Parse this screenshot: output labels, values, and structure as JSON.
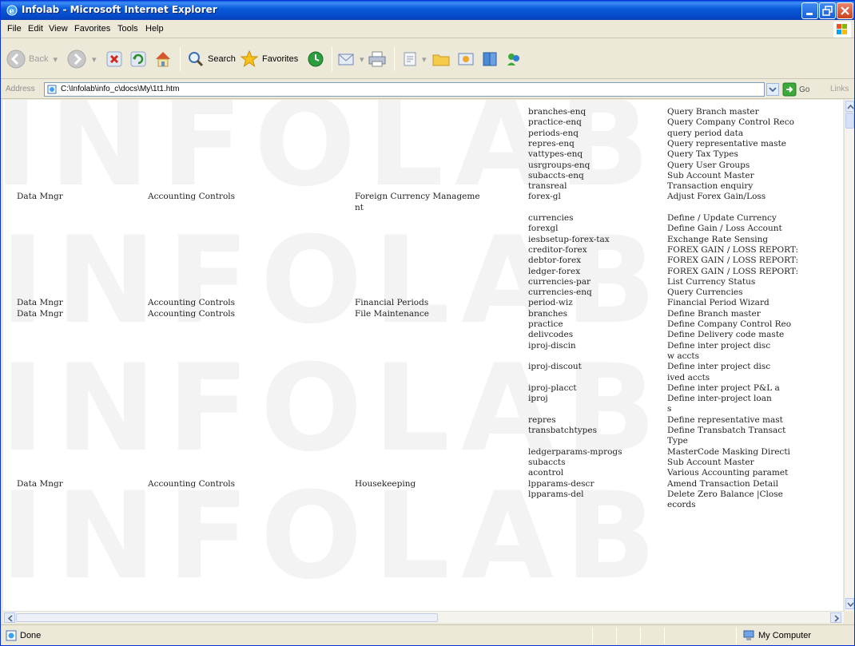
{
  "window": {
    "title": "Infolab - Microsoft Internet Explorer"
  },
  "menu": {
    "items": [
      "File",
      "Edit",
      "View",
      "Favorites",
      "Tools",
      "Help"
    ]
  },
  "toolbar": {
    "back_label": "Back",
    "search_label": "Search",
    "favorites_label": "Favorites"
  },
  "address": {
    "label": "Address",
    "url": "C:\\Infolab\\info_c\\docs\\My\\1t1.htm",
    "go_label": "Go",
    "links_label": "Links"
  },
  "watermark": {
    "text": "INFOLAB"
  },
  "report": {
    "rows": [
      {
        "c1": "",
        "c2": "",
        "c3": "",
        "c4": "branches-enq",
        "c5": "Query Branch master"
      },
      {
        "c1": "",
        "c2": "",
        "c3": "",
        "c4": "practice-enq",
        "c5": "Query Company Control Reco"
      },
      {
        "c1": "",
        "c2": "",
        "c3": "",
        "c4": "periods-enq",
        "c5": "query period data"
      },
      {
        "c1": "",
        "c2": "",
        "c3": "",
        "c4": "repres-enq",
        "c5": "Query representative maste"
      },
      {
        "c1": "",
        "c2": "",
        "c3": "",
        "c4": "vattypes-enq",
        "c5": "Query Tax Types"
      },
      {
        "c1": "",
        "c2": "",
        "c3": "",
        "c4": "usrgroups-enq",
        "c5": "Query User Groups"
      },
      {
        "c1": "",
        "c2": "",
        "c3": "",
        "c4": "subaccts-enq",
        "c5": "Sub Account Master"
      },
      {
        "c1": "",
        "c2": "",
        "c3": "",
        "c4": "transreal",
        "c5": "Transaction enquiry"
      },
      {
        "c1": "Data Mngr",
        "c2": "Accounting Controls",
        "c3": "Foreign Currency Manageme",
        "c4": "forex-gl",
        "c5": "Adjust Forex Gain/Loss"
      },
      {
        "c1": "",
        "c2": "",
        "c3": "nt",
        "c4": "",
        "c5": ""
      },
      {
        "c1": "",
        "c2": "",
        "c3": "",
        "c4": "currencies",
        "c5": "Define / Update Currency"
      },
      {
        "c1": "",
        "c2": "",
        "c3": "",
        "c4": "forexgl",
        "c5": "Define Gain / Loss Account"
      },
      {
        "c1": "",
        "c2": "",
        "c3": "",
        "c4": "iesbsetup-forex-tax",
        "c5": "Exchange Rate Sensing"
      },
      {
        "c1": "",
        "c2": "",
        "c3": "",
        "c4": "creditor-forex",
        "c5": "FOREX GAIN / LOSS REPORT:"
      },
      {
        "c1": "",
        "c2": "",
        "c3": "",
        "c4": "debtor-forex",
        "c5": "FOREX GAIN / LOSS REPORT:"
      },
      {
        "c1": "",
        "c2": "",
        "c3": "",
        "c4": "ledger-forex",
        "c5": "FOREX GAIN / LOSS REPORT:"
      },
      {
        "c1": "",
        "c2": "",
        "c3": "",
        "c4": "currencies-par",
        "c5": "List Currency Status"
      },
      {
        "c1": "",
        "c2": "",
        "c3": "",
        "c4": "currencies-enq",
        "c5": "Query Currencies"
      },
      {
        "c1": "Data Mngr",
        "c2": "Accounting Controls",
        "c3": "Financial Periods",
        "c4": "period-wiz",
        "c5": "Financial Period Wizard"
      },
      {
        "c1": "Data Mngr",
        "c2": "Accounting Controls",
        "c3": "File Maintenance",
        "c4": "branches",
        "c5": "Define Branch master"
      },
      {
        "c1": "",
        "c2": "",
        "c3": "",
        "c4": "practice",
        "c5": "Define Company Control Reo"
      },
      {
        "c1": "",
        "c2": "",
        "c3": "",
        "c4": "delivcodes",
        "c5": "Define Delivery code maste"
      },
      {
        "c1": "",
        "c2": "",
        "c3": "",
        "c4": "iproj-discin",
        "c5": "Define inter project disc"
      },
      {
        "c1": "",
        "c2": "",
        "c3": "",
        "c4": "",
        "c5": "w accts"
      },
      {
        "c1": "",
        "c2": "",
        "c3": "",
        "c4": "iproj-discout",
        "c5": "Define inter project disc"
      },
      {
        "c1": "",
        "c2": "",
        "c3": "",
        "c4": "",
        "c5": "ived accts"
      },
      {
        "c1": "",
        "c2": "",
        "c3": "",
        "c4": "iproj-placct",
        "c5": "Define inter project P&L a"
      },
      {
        "c1": "",
        "c2": "",
        "c3": "",
        "c4": "iproj",
        "c5": "Define inter-project loan"
      },
      {
        "c1": "",
        "c2": "",
        "c3": "",
        "c4": "",
        "c5": "s"
      },
      {
        "c1": "",
        "c2": "",
        "c3": "",
        "c4": "repres",
        "c5": "Define representative mast"
      },
      {
        "c1": "",
        "c2": "",
        "c3": "",
        "c4": "transbatchtypes",
        "c5": "Define Transbatch Transact"
      },
      {
        "c1": "",
        "c2": "",
        "c3": "",
        "c4": "",
        "c5": "Type"
      },
      {
        "c1": "",
        "c2": "",
        "c3": "",
        "c4": "ledgerparams-mprogs",
        "c5": "MasterCode Masking Directi"
      },
      {
        "c1": "",
        "c2": "",
        "c3": "",
        "c4": "subaccts",
        "c5": "Sub Account Master"
      },
      {
        "c1": "",
        "c2": "",
        "c3": "",
        "c4": "acontrol",
        "c5": "Various Accounting paramet"
      },
      {
        "c1": "Data Mngr",
        "c2": "Accounting Controls",
        "c3": "Housekeeping",
        "c4": "lpparams-descr",
        "c5": "Amend Transaction Detail"
      },
      {
        "c1": "",
        "c2": "",
        "c3": "",
        "c4": "lpparams-del",
        "c5": "Delete Zero Balance |Close"
      },
      {
        "c1": "",
        "c2": "",
        "c3": "",
        "c4": "",
        "c5": "ecords"
      }
    ]
  },
  "status": {
    "left_text": "Done",
    "zone_text": "My Computer"
  }
}
